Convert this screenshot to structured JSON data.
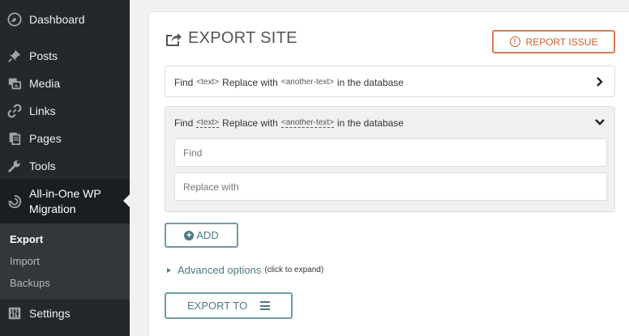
{
  "sidebar": {
    "items": [
      {
        "label": "Dashboard",
        "icon": "dashboard-icon"
      },
      {
        "label": "Posts",
        "icon": "pushpin-icon"
      },
      {
        "label": "Media",
        "icon": "media-icon"
      },
      {
        "label": "Links",
        "icon": "links-icon"
      },
      {
        "label": "Pages",
        "icon": "pages-icon"
      },
      {
        "label": "Tools",
        "icon": "wrench-icon"
      },
      {
        "label": "All-in-One WP Migration",
        "icon": "migration-icon",
        "active": true
      },
      {
        "label": "Settings",
        "icon": "settings-icon"
      }
    ],
    "submenu": [
      {
        "label": "Export",
        "current": true
      },
      {
        "label": "Import"
      },
      {
        "label": "Backups"
      }
    ]
  },
  "main": {
    "title": "EXPORT SITE",
    "title_icon": "export-share-icon",
    "report_button": "REPORT ISSUE",
    "rules": [
      {
        "find": "Find",
        "text_tag": "<text>",
        "replace": "Replace with",
        "another_tag": "<another-text>",
        "suffix": "in the database",
        "expanded": false
      },
      {
        "find": "Find",
        "text_tag": "<text>",
        "replace": "Replace with",
        "another_tag": "<another-text>",
        "suffix": "in the database",
        "expanded": true,
        "find_placeholder": "Find",
        "replace_placeholder": "Replace with"
      }
    ],
    "add_button": "ADD",
    "advanced": {
      "label": "Advanced options",
      "hint": "(click to expand)"
    },
    "export_button": "EXPORT TO"
  },
  "colors": {
    "sidebar_bg": "#23282d",
    "accent": "#4d7a82",
    "report": "#d05c2b"
  }
}
